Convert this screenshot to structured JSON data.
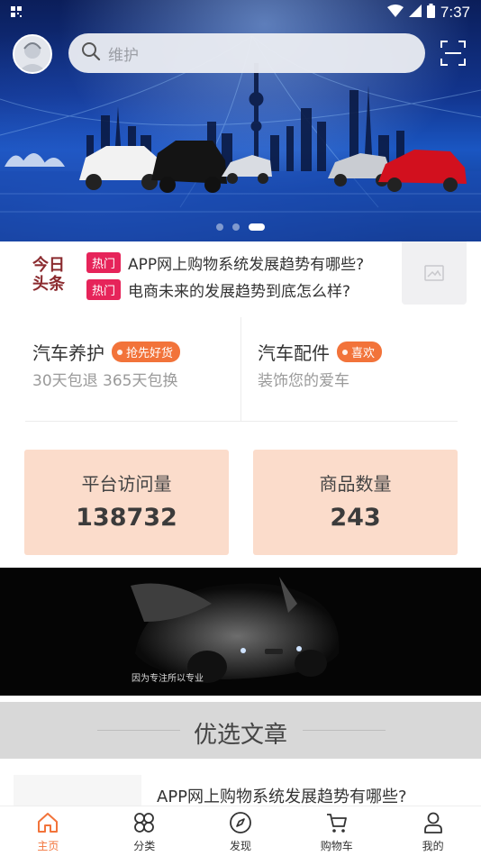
{
  "status_bar": {
    "time": "7:37"
  },
  "search": {
    "placeholder": "维护"
  },
  "headlines": {
    "logo_text": [
      "今日",
      "头条"
    ],
    "items": [
      {
        "tag": "热门",
        "title": "APP网上购物系统发展趋势有哪些?"
      },
      {
        "tag": "热门",
        "title": "电商未来的发展趋势到底怎么样?"
      }
    ]
  },
  "features": [
    {
      "title": "汽车养护",
      "badge": "抢先好货",
      "subtitle": "30天包退 365天包换"
    },
    {
      "title": "汽车配件",
      "badge": "喜欢",
      "subtitle": "装饰您的爱车"
    }
  ],
  "stats": [
    {
      "label": "平台访问量",
      "value": "138732"
    },
    {
      "label": "商品数量",
      "value": "243"
    }
  ],
  "promo": {
    "caption": "因为专注所以专业"
  },
  "section": {
    "title": "优选文章"
  },
  "articles": [
    {
      "title": "APP网上购物系统发展趋势有哪些?"
    }
  ],
  "bottom_nav": {
    "items": [
      {
        "label": "主页",
        "icon": "home-icon",
        "active": true
      },
      {
        "label": "分类",
        "icon": "category-icon",
        "active": false
      },
      {
        "label": "发现",
        "icon": "compass-icon",
        "active": false
      },
      {
        "label": "购物车",
        "icon": "cart-icon",
        "active": false
      },
      {
        "label": "我的",
        "icon": "user-icon",
        "active": false
      }
    ]
  },
  "colors": {
    "accent": "#f2733a",
    "hot_tag": "#e6245a",
    "stat_card": "#fbdccb",
    "logo": "#8b2b2f"
  }
}
